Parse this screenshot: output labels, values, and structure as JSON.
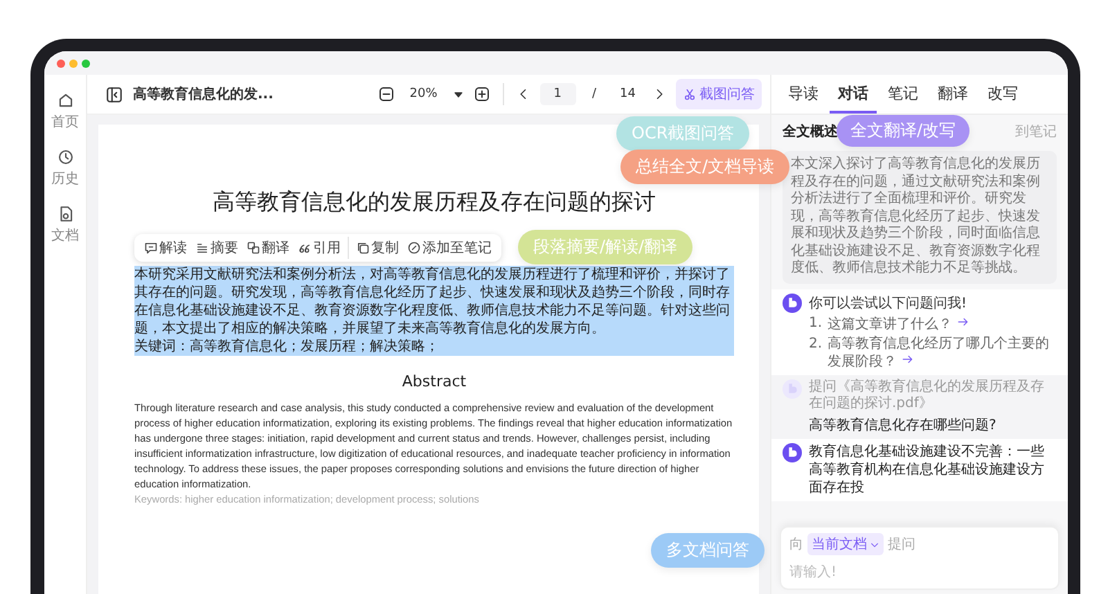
{
  "sidebar": {
    "items": [
      {
        "kind": "home",
        "label": "首页"
      },
      {
        "kind": "history",
        "label": "历史"
      },
      {
        "kind": "document",
        "label": "文档"
      }
    ]
  },
  "toolbar": {
    "doc_title": "高等教育信息化的发...",
    "zoom": "20%",
    "page": "1",
    "page_separator": "/",
    "page_count": "14",
    "screenshot_button": "截图问答"
  },
  "document": {
    "title": "高等教育信息化的发展历程及存在问题的探讨",
    "selection_toolbar": [
      {
        "kind": "interpret",
        "label": "解读"
      },
      {
        "kind": "summary",
        "label": "摘要"
      },
      {
        "kind": "translate",
        "label": "翻译"
      },
      {
        "kind": "quote",
        "label": "引用"
      },
      {
        "kind": "copy",
        "label": "复制"
      },
      {
        "kind": "note",
        "label": "添加至笔记"
      }
    ],
    "selected_paragraph": "本研究采用文献研究法和案例分析法，对高等教育信息化的发展历程进行了梳理和评价，并探讨了其存在的问题。研究发现，高等教育信息化经历了起步、快速发展和现状及趋势三个阶段，同时存在信息化基础设施建设不足、教育资源数字化程度低、教师信息技术能力不足等问题。针对这些问题，本文提出了相应的解决策略，并展望了未来高等教育信息化的发展方向。",
    "selected_keywords": "关键词：高等教育信息化；发展历程；解决策略；",
    "abstract_heading": "Abstract",
    "abstract": "Through literature research and case analysis, this study conducted a comprehensive review and evaluation of the development process of higher education informatization, exploring its existing problems. The findings reveal that higher education informatization has undergone three stages: initiation, rapid development and current status and trends. However, challenges persist, including insufficient informatization infrastructure, low digitization of educational resources, and inadequate teacher proficiency in information technology. To address these issues, the paper proposes corresponding solutions and envisions the future direction of higher education informatization.",
    "abstract_keywords": "Keywords: higher education informatization; development process; solutions"
  },
  "panel": {
    "tabs": [
      {
        "label": "导读",
        "selected": false
      },
      {
        "label": "对话",
        "selected": true
      },
      {
        "label": "笔记",
        "selected": false
      },
      {
        "label": "翻译",
        "selected": false
      },
      {
        "label": "改写",
        "selected": false
      }
    ],
    "summary_title": "全文概述",
    "summary_action": "到笔记",
    "summary": "本文深入探讨了高等教育信息化的发展历程及存在的问题，通过文献研究法和案例分析法进行了全面梳理和评价。研究发现，高等教育信息化经历了起步、快速发展和现状及趋势三个阶段，同时面临信息化基础设施建设不足、教育资源数字化程度低、教师信息技术能力不足等挑战。",
    "suggest_title": "你可以尝试以下问题问我!",
    "suggestions": [
      {
        "number": "1.",
        "text": "这篇文章讲了什么？"
      },
      {
        "number": "2.",
        "text": "高等教育信息化经历了哪几个主要的发展阶段？"
      }
    ],
    "question_source": "提问《高等教育信息化的发展历程及存在问题的探讨.pdf》",
    "question": "高等教育信息化存在哪些问题?",
    "answer": "教育信息化基础设施建设不完善：一些高等教育机构在信息化基础设施建设方面存在投",
    "input": {
      "prefix": "向",
      "scope": "当前文档",
      "suffix": "提问",
      "placeholder": "请输入!"
    }
  },
  "callouts": [
    {
      "text": "OCR截图问答",
      "color": "#b2e3e3"
    },
    {
      "text": "段落摘要/解读/翻译",
      "color": "#d4e496"
    },
    {
      "text": "总结全文/文档导读",
      "color": "#f5a184"
    },
    {
      "text": "全文翻译/改写",
      "color": "#a892f4"
    },
    {
      "text": "多文档问答",
      "color": "#9ccaf6"
    }
  ]
}
